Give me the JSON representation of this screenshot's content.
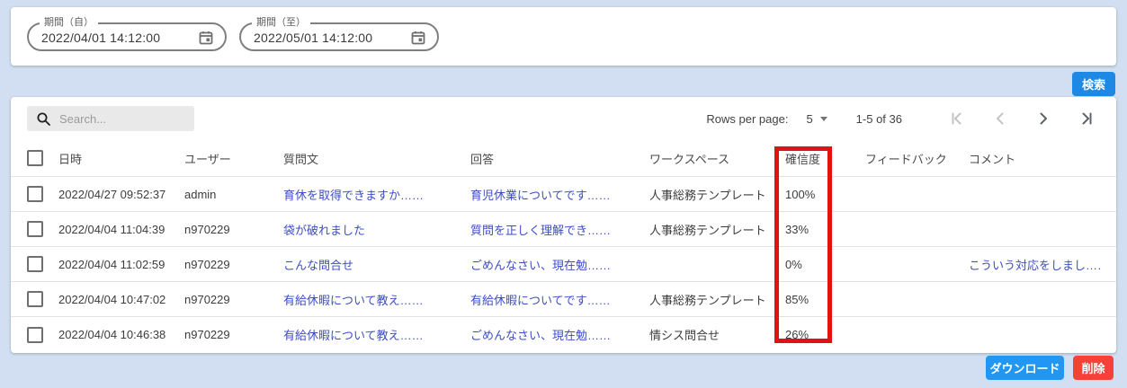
{
  "filters": {
    "from": {
      "label": "期間（自）",
      "value": "2022/04/01 14:12:00"
    },
    "to": {
      "label": "期間（至）",
      "value": "2022/05/01 14:12:00"
    },
    "search_button": "検索"
  },
  "table": {
    "search_placeholder": "Search...",
    "pagination": {
      "rows_per_page_label": "Rows per page:",
      "rows_per_page_value": "5",
      "range_label": "1-5 of 36"
    },
    "columns": [
      "日時",
      "ユーザー",
      "質問文",
      "回答",
      "ワークスペース",
      "確信度",
      "フィードバック",
      "コメント"
    ],
    "rows": [
      {
        "datetime": "2022/04/27 09:52:37",
        "user": "admin",
        "question": "育休を取得できますか……",
        "answer": "育児休業についてです……",
        "workspace": "人事総務テンプレート",
        "confidence": "100%",
        "feedback": "",
        "comment": ""
      },
      {
        "datetime": "2022/04/04 11:04:39",
        "user": "n970229",
        "question": "袋が破れました",
        "answer": "質問を正しく理解でき……",
        "workspace": "人事総務テンプレート",
        "confidence": "33%",
        "feedback": "",
        "comment": ""
      },
      {
        "datetime": "2022/04/04 11:02:59",
        "user": "n970229",
        "question": "こんな問合せ",
        "answer": "ごめんなさい、現在勉……",
        "workspace": "",
        "confidence": "0%",
        "feedback": "",
        "comment": "こういう対応をしまし……"
      },
      {
        "datetime": "2022/04/04 10:47:02",
        "user": "n970229",
        "question": "有給休暇について教え……",
        "answer": "有給休暇についてです……",
        "workspace": "人事総務テンプレート",
        "confidence": "85%",
        "feedback": "",
        "comment": ""
      },
      {
        "datetime": "2022/04/04 10:46:38",
        "user": "n970229",
        "question": "有給休暇について教え……",
        "answer": "ごめんなさい、現在勉……",
        "workspace": "情シス問合せ",
        "confidence": "26%",
        "feedback": "",
        "comment": ""
      }
    ]
  },
  "footer": {
    "download_button": "ダウンロード",
    "delete_button": "削除"
  },
  "annotation": {
    "highlighted_column": "確信度",
    "highlight_color": "#e01212"
  },
  "colors": {
    "page_background": "#d2dff2",
    "primary_blue": "#1e88e5",
    "download_blue": "#2196f3",
    "delete_red": "#f44336",
    "link_blue": "#3d4dc8"
  }
}
